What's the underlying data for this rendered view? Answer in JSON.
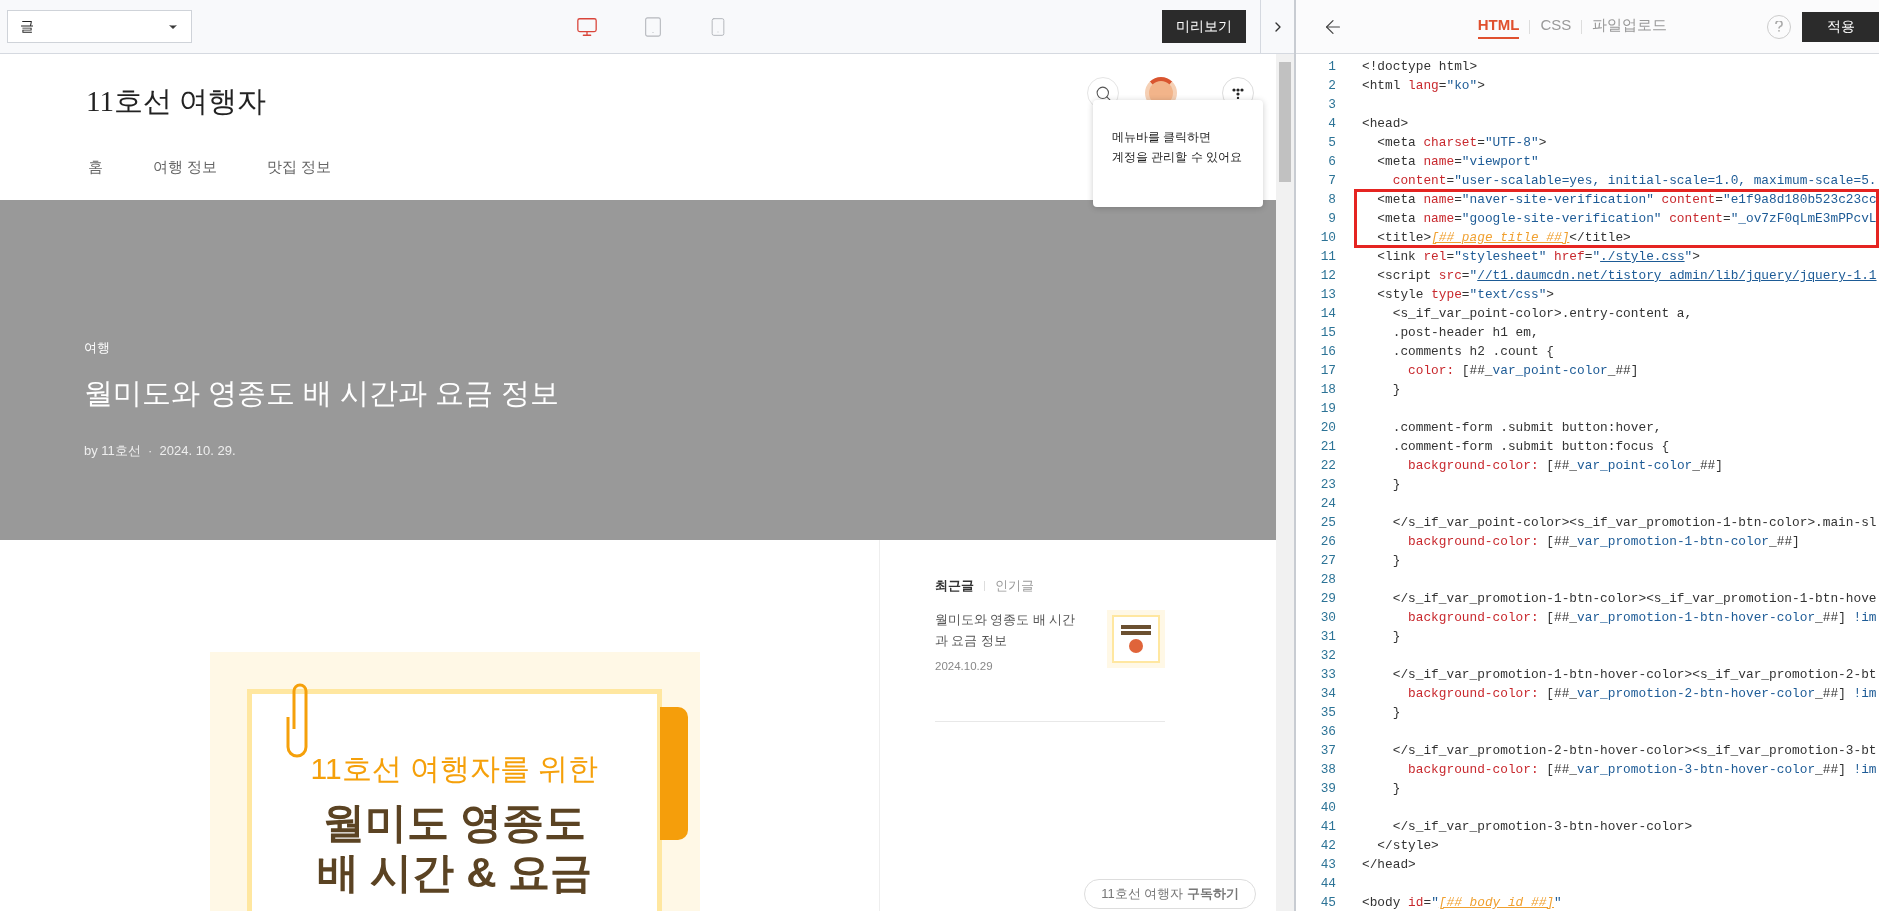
{
  "toolbar": {
    "select": {
      "value": "글"
    },
    "devices": [
      {
        "kind": "desktop",
        "selected": true
      },
      {
        "kind": "tablet",
        "selected": false
      },
      {
        "kind": "mobile",
        "selected": false
      }
    ],
    "preview_button": "미리보기"
  },
  "preview": {
    "blog_title": "11호선 여행자",
    "nav": [
      "홈",
      "여행 정보",
      "맛집 정보"
    ],
    "tooltip": [
      "메뉴바를 클릭하면",
      "계정을 관리할 수 있어요"
    ],
    "hero": {
      "category": "여행",
      "title": "월미도와 영종도 배 시간과 요금 정보",
      "byline": "by 11호선  ·  2024. 10. 29."
    },
    "cover_image": {
      "subtitle": "11호선 여행자를 위한",
      "title_lines": [
        "월미도 영종도",
        "배 시간 & 요금"
      ]
    },
    "sidebar": {
      "tabs": [
        {
          "label": "최근글",
          "selected": true
        },
        {
          "label": "인기글",
          "selected": false
        }
      ],
      "posts": [
        {
          "title": "월미도와 영종도 배 시간과 요금 정보",
          "date": "2024.10.29"
        }
      ],
      "subscribe": "11호선 여행자 **구독하기**"
    }
  },
  "editor": {
    "tabs": [
      {
        "label": "HTML",
        "selected": true
      },
      {
        "label": "CSS",
        "selected": false
      },
      {
        "label": "파일업로드",
        "selected": false
      }
    ],
    "apply_button": "적용",
    "blocks": [
      {
        "highlighted": false,
        "lines": [
          {
            "num": "1",
            "tokens": [
              {
                "kind": "tag",
                "text": "<!doctype html>"
              }
            ]
          },
          {
            "num": "2",
            "tokens": [
              {
                "kind": "tag",
                "text": "<html "
              },
              {
                "kind": "attr",
                "text": "lang"
              },
              {
                "kind": "tag",
                "text": "="
              },
              {
                "kind": "str",
                "text": "\"ko\""
              },
              {
                "kind": "tag",
                "text": ">"
              }
            ]
          },
          {
            "num": "3"
          },
          {
            "num": "4",
            "tokens": [
              {
                "kind": "tag",
                "text": "<head>"
              }
            ]
          },
          {
            "num": "5",
            "tokens": [
              {
                "kind": "tag",
                "text": "  <meta "
              },
              {
                "kind": "attr",
                "text": "charset"
              },
              {
                "kind": "tag",
                "text": "="
              },
              {
                "kind": "str",
                "text": "\"UTF-8\""
              },
              {
                "kind": "tag",
                "text": ">"
              }
            ]
          },
          {
            "num": "6",
            "tokens": [
              {
                "kind": "tag",
                "text": "  <meta "
              },
              {
                "kind": "attr",
                "text": "name"
              },
              {
                "kind": "tag",
                "text": "="
              },
              {
                "kind": "str",
                "text": "\"viewport\""
              }
            ]
          },
          {
            "num": "7",
            "tokens": [
              {
                "kind": "attr",
                "text": "    content"
              },
              {
                "kind": "tag",
                "text": "="
              },
              {
                "kind": "str",
                "text": "\"user-scalable=yes, initial-scale=1.0, maximum-scale=5."
              }
            ]
          }
        ]
      },
      {
        "highlighted": true,
        "lines": [
          {
            "num": "8",
            "tokens": [
              {
                "kind": "tag",
                "text": "  <meta "
              },
              {
                "kind": "attr",
                "text": "name"
              },
              {
                "kind": "tag",
                "text": "="
              },
              {
                "kind": "str",
                "text": "\"naver-site-verification\""
              },
              {
                "kind": "attr",
                "text": " content"
              },
              {
                "kind": "tag",
                "text": "="
              },
              {
                "kind": "str",
                "text": "\"e1f9a8d180b523c23cc"
              }
            ]
          },
          {
            "num": "9",
            "tokens": [
              {
                "kind": "tag",
                "text": "  <meta "
              },
              {
                "kind": "attr",
                "text": "name"
              },
              {
                "kind": "tag",
                "text": "="
              },
              {
                "kind": "str",
                "text": "\"google-site-verification\""
              },
              {
                "kind": "attr",
                "text": " content"
              },
              {
                "kind": "tag",
                "text": "="
              },
              {
                "kind": "str",
                "text": "\"_ov7zF0qLmE3mPPcvL"
              }
            ]
          },
          {
            "num": "10",
            "tokens": [
              {
                "kind": "tag",
                "text": "  <title>"
              },
              {
                "kind": "tpl",
                "text": "[##_page_title_##]"
              },
              {
                "kind": "tag",
                "text": "</title>"
              }
            ]
          }
        ]
      },
      {
        "highlighted": false,
        "lines": [
          {
            "num": "11",
            "tokens": [
              {
                "kind": "tag",
                "text": "  <link "
              },
              {
                "kind": "attr",
                "text": "rel"
              },
              {
                "kind": "tag",
                "text": "="
              },
              {
                "kind": "str",
                "text": "\"stylesheet\""
              },
              {
                "kind": "attr",
                "text": " href"
              },
              {
                "kind": "tag",
                "text": "="
              },
              {
                "kind": "str",
                "text": "\""
              },
              {
                "kind": "link",
                "text": "./style.css"
              },
              {
                "kind": "str",
                "text": "\""
              },
              {
                "kind": "tag",
                "text": ">"
              }
            ]
          },
          {
            "num": "12",
            "tokens": [
              {
                "kind": "tag",
                "text": "  <script "
              },
              {
                "kind": "attr",
                "text": "src"
              },
              {
                "kind": "tag",
                "text": "="
              },
              {
                "kind": "str",
                "text": "\""
              },
              {
                "kind": "link",
                "text": "//t1.daumcdn.net/tistory_admin/lib/jquery/jquery-1.1"
              }
            ]
          },
          {
            "num": "13",
            "tokens": [
              {
                "kind": "tag",
                "text": "  <style "
              },
              {
                "kind": "attr",
                "text": "type"
              },
              {
                "kind": "tag",
                "text": "="
              },
              {
                "kind": "str",
                "text": "\"text/css\""
              },
              {
                "kind": "tag",
                "text": ">"
              }
            ]
          },
          {
            "num": "14",
            "tokens": [
              {
                "kind": "tag",
                "text": "    <s_if_var_point-color>.entry-content a,"
              }
            ]
          },
          {
            "num": "15",
            "tokens": [
              {
                "kind": "tag",
                "text": "    .post-header h1 em,"
              }
            ]
          },
          {
            "num": "16",
            "tokens": [
              {
                "kind": "tag",
                "text": "    .comments h2 .count {"
              }
            ]
          },
          {
            "num": "17",
            "tokens": [
              {
                "kind": "attr",
                "text": "      color:"
              },
              {
                "kind": "tag",
                "text": " [##_"
              },
              {
                "kind": "str",
                "text": "var_point-color"
              },
              {
                "kind": "tag",
                "text": "_##]"
              }
            ]
          },
          {
            "num": "18",
            "tokens": [
              {
                "kind": "tag",
                "text": "    }"
              }
            ]
          },
          {
            "num": "19"
          },
          {
            "num": "20",
            "tokens": [
              {
                "kind": "tag",
                "text": "    .comment-form .submit button:hover,"
              }
            ]
          },
          {
            "num": "21",
            "tokens": [
              {
                "kind": "tag",
                "text": "    .comment-form .submit button:focus {"
              }
            ]
          },
          {
            "num": "22",
            "tokens": [
              {
                "kind": "attr",
                "text": "      background-color:"
              },
              {
                "kind": "tag",
                "text": " [##_"
              },
              {
                "kind": "str",
                "text": "var_point-color"
              },
              {
                "kind": "tag",
                "text": "_##]"
              }
            ]
          },
          {
            "num": "23",
            "tokens": [
              {
                "kind": "tag",
                "text": "    }"
              }
            ]
          },
          {
            "num": "24"
          },
          {
            "num": "25",
            "tokens": [
              {
                "kind": "tag",
                "text": "    </s_if_var_point-color><s_if_var_promotion-1-btn-color>.main-sl"
              }
            ]
          },
          {
            "num": "26",
            "tokens": [
              {
                "kind": "attr",
                "text": "      background-color:"
              },
              {
                "kind": "tag",
                "text": " [##_"
              },
              {
                "kind": "str",
                "text": "var_promotion-1-btn-color"
              },
              {
                "kind": "tag",
                "text": "_##]"
              }
            ]
          },
          {
            "num": "27",
            "tokens": [
              {
                "kind": "tag",
                "text": "    }"
              }
            ]
          },
          {
            "num": "28"
          },
          {
            "num": "29",
            "tokens": [
              {
                "kind": "tag",
                "text": "    </s_if_var_promotion-1-btn-color><s_if_var_promotion-1-btn-hove"
              }
            ]
          },
          {
            "num": "30",
            "tokens": [
              {
                "kind": "attr",
                "text": "      background-color:"
              },
              {
                "kind": "tag",
                "text": " [##_"
              },
              {
                "kind": "str",
                "text": "var_promotion-1-btn-hover-color"
              },
              {
                "kind": "tag",
                "text": "_##] "
              },
              {
                "kind": "str",
                "text": "!im"
              }
            ]
          },
          {
            "num": "31",
            "tokens": [
              {
                "kind": "tag",
                "text": "    }"
              }
            ]
          },
          {
            "num": "32"
          },
          {
            "num": "33",
            "tokens": [
              {
                "kind": "tag",
                "text": "    </s_if_var_promotion-1-btn-hover-color><s_if_var_promotion-2-bt"
              }
            ]
          },
          {
            "num": "34",
            "tokens": [
              {
                "kind": "attr",
                "text": "      background-color:"
              },
              {
                "kind": "tag",
                "text": " [##_"
              },
              {
                "kind": "str",
                "text": "var_promotion-2-btn-hover-color"
              },
              {
                "kind": "tag",
                "text": "_##] "
              },
              {
                "kind": "str",
                "text": "!im"
              }
            ]
          },
          {
            "num": "35",
            "tokens": [
              {
                "kind": "tag",
                "text": "    }"
              }
            ]
          },
          {
            "num": "36"
          },
          {
            "num": "37",
            "tokens": [
              {
                "kind": "tag",
                "text": "    </s_if_var_promotion-2-btn-hover-color><s_if_var_promotion-3-bt"
              }
            ]
          },
          {
            "num": "38",
            "tokens": [
              {
                "kind": "attr",
                "text": "      background-color:"
              },
              {
                "kind": "tag",
                "text": " [##_"
              },
              {
                "kind": "str",
                "text": "var_promotion-3-btn-hover-color"
              },
              {
                "kind": "tag",
                "text": "_##] "
              },
              {
                "kind": "str",
                "text": "!im"
              }
            ]
          },
          {
            "num": "39",
            "tokens": [
              {
                "kind": "tag",
                "text": "    }"
              }
            ]
          },
          {
            "num": "40"
          },
          {
            "num": "41",
            "tokens": [
              {
                "kind": "tag",
                "text": "    </s_if_var_promotion-3-btn-hover-color>"
              }
            ]
          },
          {
            "num": "42",
            "tokens": [
              {
                "kind": "tag",
                "text": "  </style>"
              }
            ]
          },
          {
            "num": "43",
            "tokens": [
              {
                "kind": "tag",
                "text": "</head>"
              }
            ]
          },
          {
            "num": "44"
          },
          {
            "num": "45",
            "tokens": [
              {
                "kind": "tag",
                "text": "<body "
              },
              {
                "kind": "attr",
                "text": "id"
              },
              {
                "kind": "tag",
                "text": "="
              },
              {
                "kind": "str",
                "text": "\""
              },
              {
                "kind": "tpl",
                "text": "[##_body_id_##]"
              },
              {
                "kind": "str",
                "text": "\""
              }
            ]
          }
        ]
      }
    ]
  }
}
